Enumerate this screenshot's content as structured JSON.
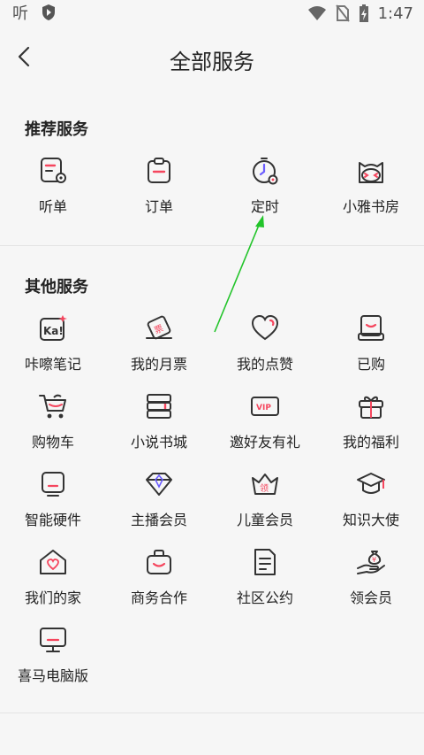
{
  "status_bar": {
    "time": "1:47",
    "left_icons": [
      "app-icon",
      "shield-play-icon"
    ],
    "right_icons": [
      "wifi-icon",
      "no-sim-icon",
      "battery-charging-icon"
    ]
  },
  "header": {
    "title": "全部服务"
  },
  "recommended": {
    "title": "推荐服务",
    "items": [
      {
        "label": "听单",
        "icon": "playlist-icon"
      },
      {
        "label": "订单",
        "icon": "order-clipboard-icon"
      },
      {
        "label": "定时",
        "icon": "timer-icon"
      },
      {
        "label": "小雅书房",
        "icon": "cat-face-icon"
      }
    ]
  },
  "other": {
    "title": "其他服务",
    "items": [
      {
        "label": "咔嚓笔记",
        "icon": "ka-note-icon"
      },
      {
        "label": "我的月票",
        "icon": "monthly-ticket-icon"
      },
      {
        "label": "我的点赞",
        "icon": "heart-icon"
      },
      {
        "label": "已购",
        "icon": "purchased-box-icon"
      },
      {
        "label": "购物车",
        "icon": "shopping-cart-icon"
      },
      {
        "label": "小说书城",
        "icon": "book-stack-icon"
      },
      {
        "label": "邀好友有礼",
        "icon": "vip-ticket-icon"
      },
      {
        "label": "我的福利",
        "icon": "gift-icon"
      },
      {
        "label": "智能硬件",
        "icon": "smart-device-icon"
      },
      {
        "label": "主播会员",
        "icon": "diamond-icon"
      },
      {
        "label": "儿童会员",
        "icon": "kids-crown-icon"
      },
      {
        "label": "知识大使",
        "icon": "graduation-cap-icon"
      },
      {
        "label": "我们的家",
        "icon": "home-heart-icon"
      },
      {
        "label": "商务合作",
        "icon": "briefcase-icon"
      },
      {
        "label": "社区公约",
        "icon": "document-icon"
      },
      {
        "label": "领会员",
        "icon": "hand-money-bag-icon"
      },
      {
        "label": "喜马电脑版",
        "icon": "desktop-icon"
      }
    ],
    "badges": {
      "heart": "♥",
      "vip": "VIP",
      "ka": "Ka!",
      "kids": "领",
      "money": "¥",
      "ticket": "票"
    }
  },
  "colors": {
    "accent": "#f5465e",
    "icon_stroke": "#333333",
    "annotation_arrow": "#22c42a"
  }
}
